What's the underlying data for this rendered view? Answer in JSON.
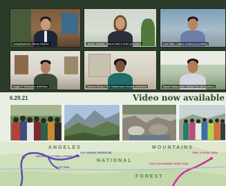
{
  "video_call": {
    "participants": [
      {
        "caption": "Congressman Jimmy Gomez"
      },
      {
        "caption": "Jackie Ostfeld, Sierra Club & OAC (she/her)"
      },
      {
        "caption": "Luis Villa - Latino Outdoors (he/him)"
      },
      {
        "caption": "Angel P. Gonzalez (He/Him)"
      },
      {
        "caption": "Sharon Mosa | The Wilderness Society (she/her)"
      },
      {
        "caption": "Bryan Matsumoto, Nature For All (he/him)"
      }
    ]
  },
  "banner": {
    "date": "6.29.21",
    "headline": "Video now available"
  },
  "map": {
    "labels": [
      "ANGELES",
      "NATIONAL",
      "FOREST",
      "MOUNTAINS"
    ],
    "route_labels": [
      "NATURE HILLS TRAIL & PICNIC AREA",
      "LOOP TRAIL",
      "SAN GABRIEL RESERVOIR",
      "EAST SAN GABRIEL RIVER TRAIL",
      "TRAIL & PICNIC AREA"
    ]
  }
}
